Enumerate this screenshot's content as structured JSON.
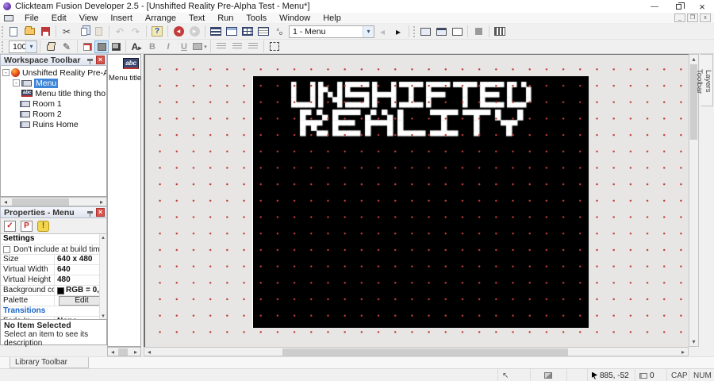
{
  "window": {
    "title": "Clickteam Fusion Developer 2.5 - [Unshifted Reality Pre-Alpha Test - Menu*]"
  },
  "menubar": {
    "items": [
      "File",
      "Edit",
      "View",
      "Insert",
      "Arrange",
      "Text",
      "Run",
      "Tools",
      "Window",
      "Help"
    ]
  },
  "toolbar": {
    "frame_selector": "1 - Menu",
    "zoom_level": "100%",
    "bold_label": "B",
    "italic_label": "I",
    "underline_label": "U"
  },
  "workspace": {
    "title": "Workspace Toolbar",
    "root_label": "Unshifted Reality Pre-Alpha Te",
    "items": [
      {
        "label": "Menu"
      },
      {
        "label": "Menu title thing tho"
      },
      {
        "label": "Room 1"
      },
      {
        "label": "Room 2"
      },
      {
        "label": "Ruins Home"
      }
    ]
  },
  "object_panel": {
    "icon_label": "abc",
    "item_label": "Menu title t"
  },
  "properties": {
    "title": "Properties - Menu",
    "section_settings": "Settings",
    "checkbox_label": "Don't include at build time",
    "rows": [
      {
        "label": "Size",
        "value": "640 x 480"
      },
      {
        "label": "Virtual Width",
        "value": "640"
      },
      {
        "label": "Virtual Height",
        "value": "480"
      },
      {
        "label": "Background color",
        "value": "RGB = 0,"
      },
      {
        "label": "Palette",
        "value": "Edit"
      }
    ],
    "section_transitions": "Transitions",
    "fade_label": "Fade In",
    "fade_value": "None",
    "no_item_title": "No Item Selected",
    "no_item_desc": "Select an item to see its description"
  },
  "frame": {
    "title_lines": [
      "UNSHIFTED",
      "REALITY"
    ],
    "bg_color": "#000000",
    "text_color": "#ffffff"
  },
  "layers_tab_label": "Layers Toolbar",
  "library_tab_label": "Library Toolbar",
  "statusbar": {
    "coords": "885, -52",
    "object_count": "0",
    "cap_label": "CAP",
    "num_label": "NUM"
  }
}
